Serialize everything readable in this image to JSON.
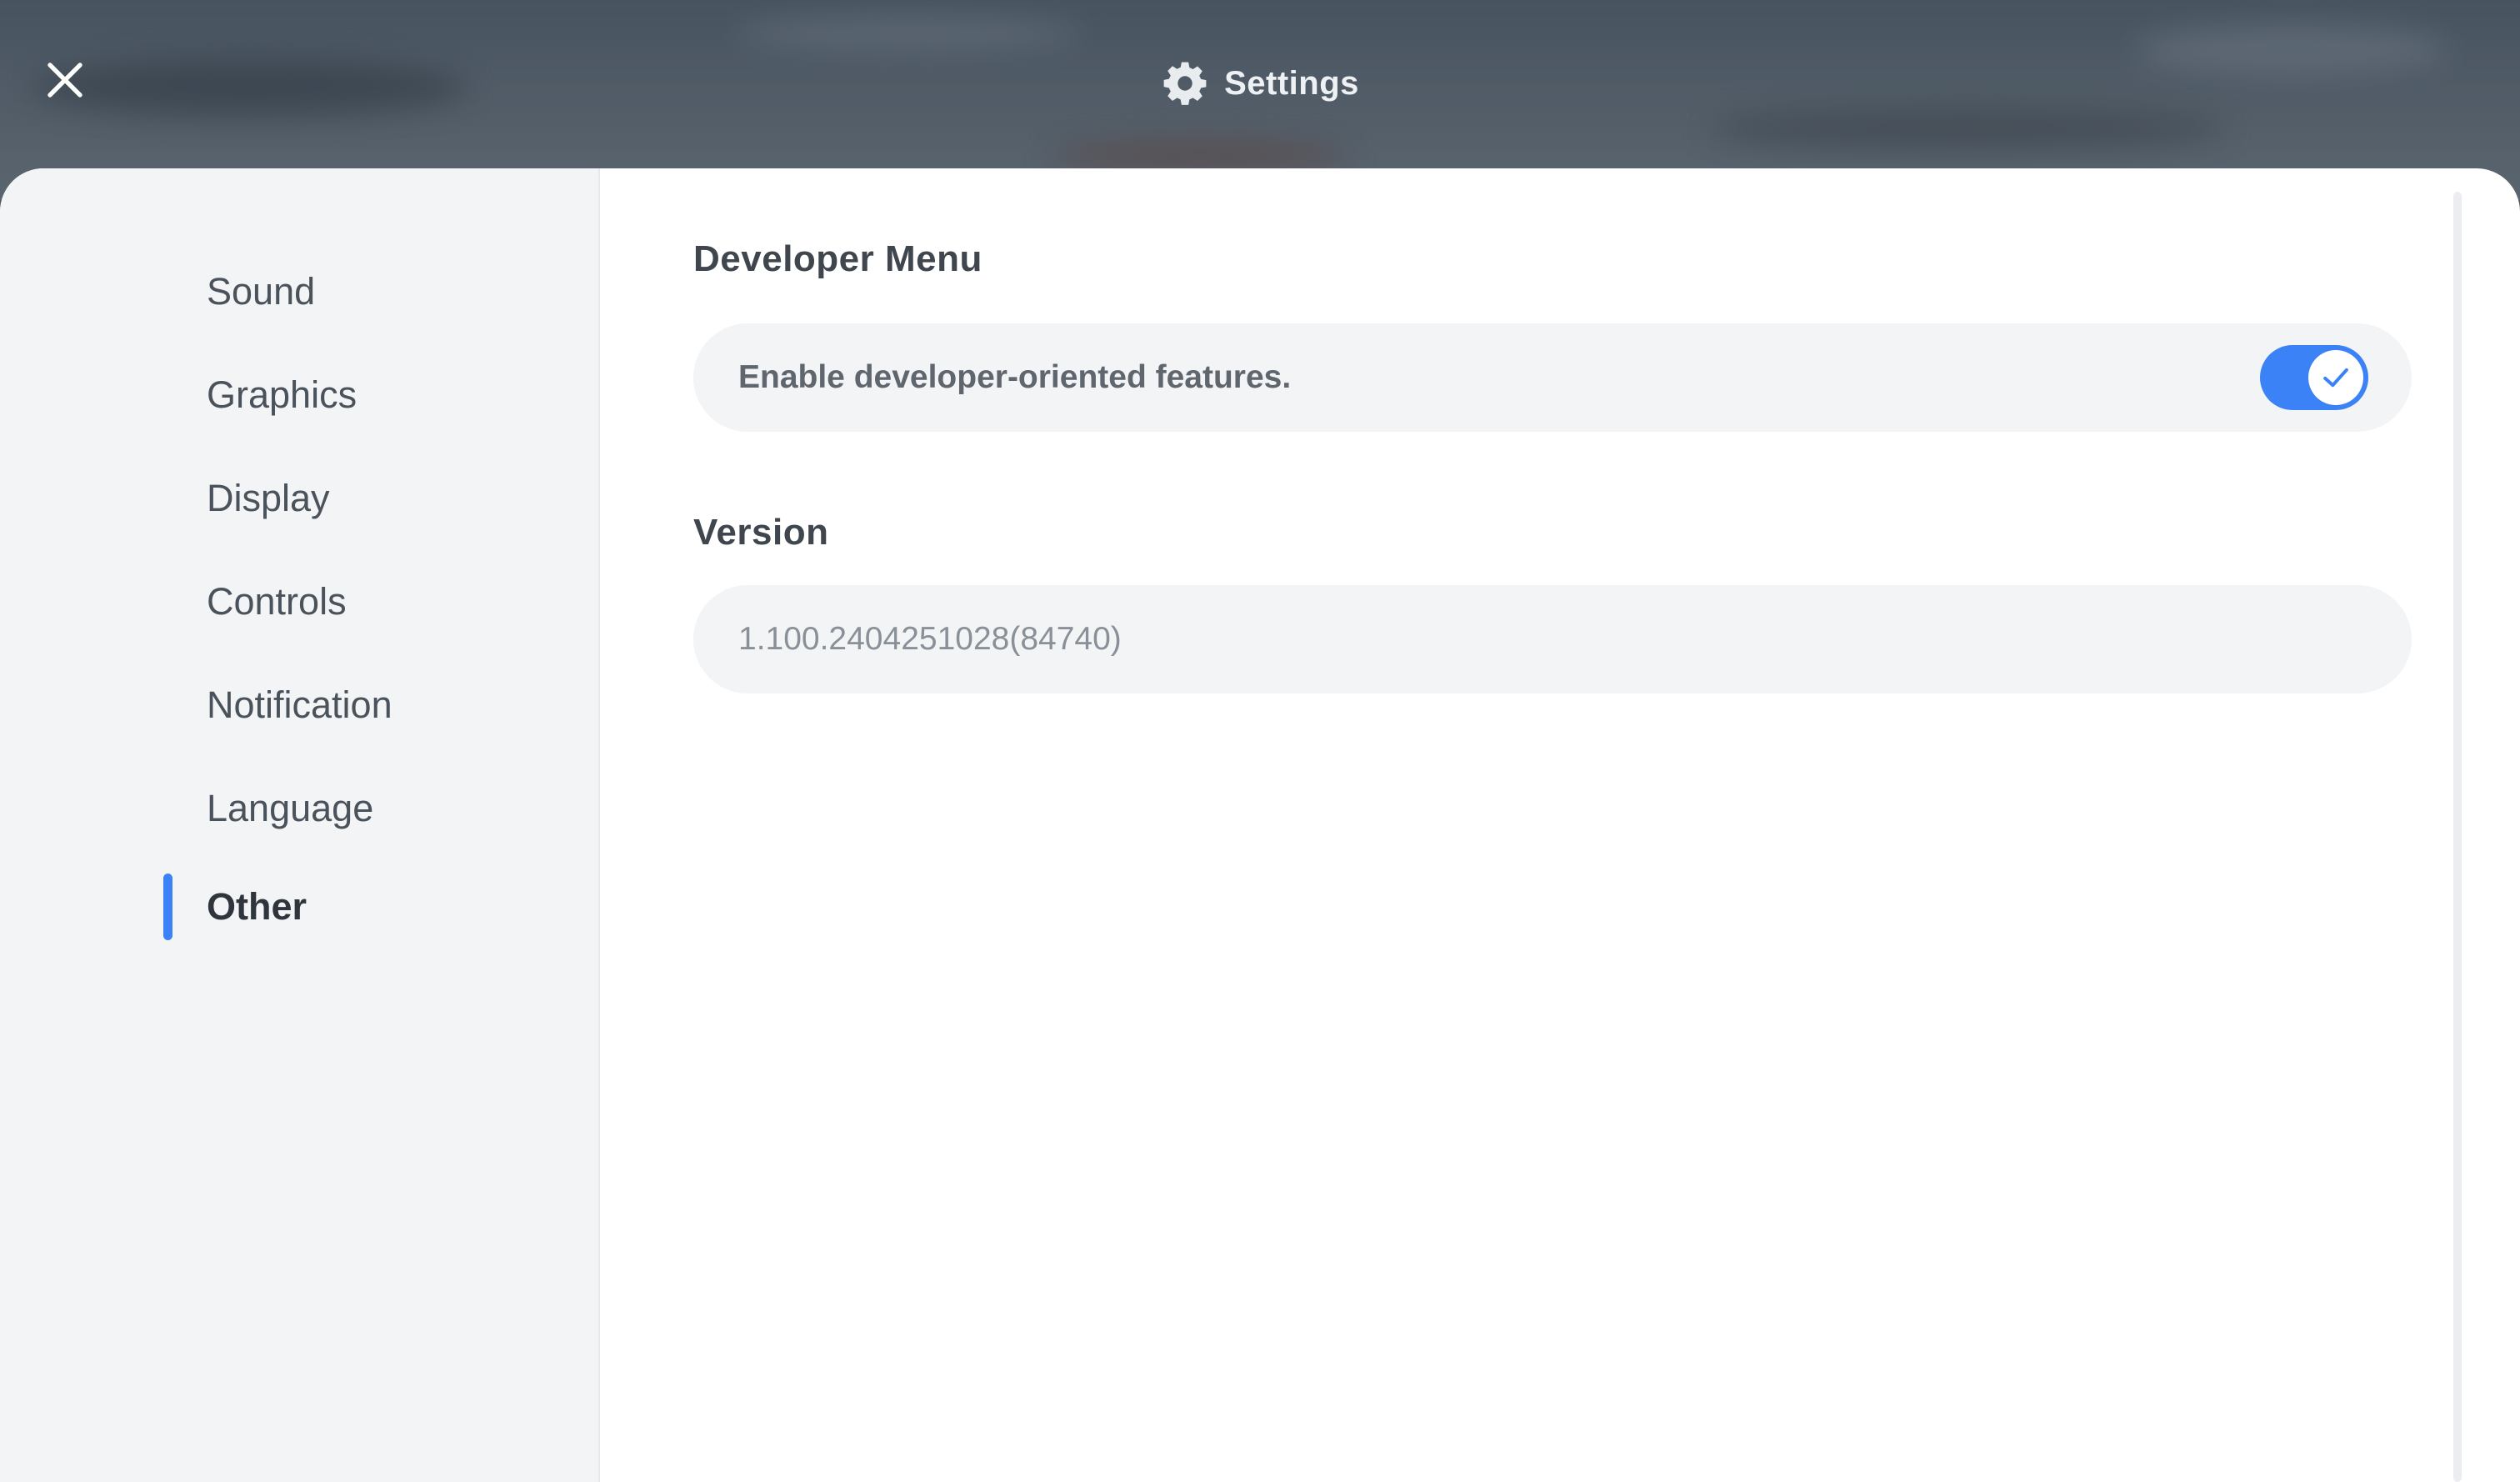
{
  "window": {
    "title": "Settings"
  },
  "sidebar": {
    "items": [
      {
        "label": "Sound"
      },
      {
        "label": "Graphics"
      },
      {
        "label": "Display"
      },
      {
        "label": "Controls"
      },
      {
        "label": "Notification"
      },
      {
        "label": "Language"
      },
      {
        "label": "Other"
      }
    ],
    "active": "Other"
  },
  "developer_menu": {
    "title": "Developer Menu",
    "description": "Enable developer-oriented features.",
    "enabled": true
  },
  "version": {
    "title": "Version",
    "value": "1.100.2404251028(84740)"
  },
  "icons": {
    "close": "close-icon",
    "settings": "gear-icon",
    "toggle_check": "check-icon"
  },
  "colors": {
    "accent": "#3b82f6",
    "sidebar_bg": "#f3f4f6",
    "panel_bg": "#ffffff",
    "header_bg": "#4b5662"
  }
}
